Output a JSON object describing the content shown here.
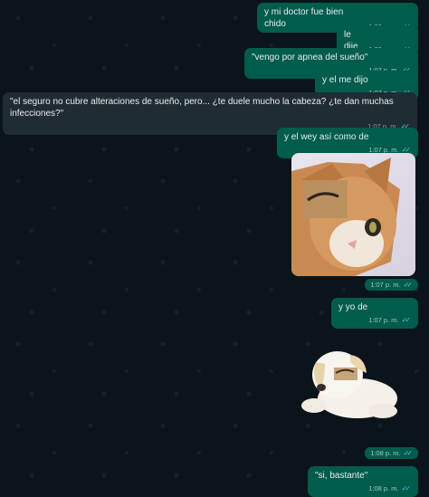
{
  "messages": [
    {
      "text": "y mi doctor fue bien chido",
      "time": "1:06 p. m."
    },
    {
      "text": "le dije",
      "time": "1:06 p. m."
    },
    {
      "text": "\"vengo por apnea del sueño\"",
      "time": "1:07 p. m."
    },
    {
      "text": "y el me dijo",
      "time": "1:07 p. m."
    },
    {
      "text": "\"el seguro no cubre alteraciones de sueño, pero... ¿te duele mucho la cabeza? ¿te dan muchas infecciones?\"",
      "time": "1:07 p. m."
    },
    {
      "text": "y el wey así como de",
      "time": "1:07 p. m."
    },
    {
      "time": "1:07 p. m."
    },
    {
      "text": "y yo de",
      "time": "1:07 p. m."
    },
    {
      "time": "1:08 p. m."
    },
    {
      "text": "\"si, bastante\"",
      "time": "1:08 p. m."
    }
  ],
  "icons": {
    "read_receipt": "double-check-icon",
    "cat_image": "cat-with-drawn-eyebrows-image",
    "puppy_sticker": "puppy-sticker"
  },
  "colors": {
    "background": "#0b141a",
    "outgoing_bubble": "#005c4b",
    "incoming_bubble": "#202c33",
    "read_ticks": "#53bdeb"
  }
}
